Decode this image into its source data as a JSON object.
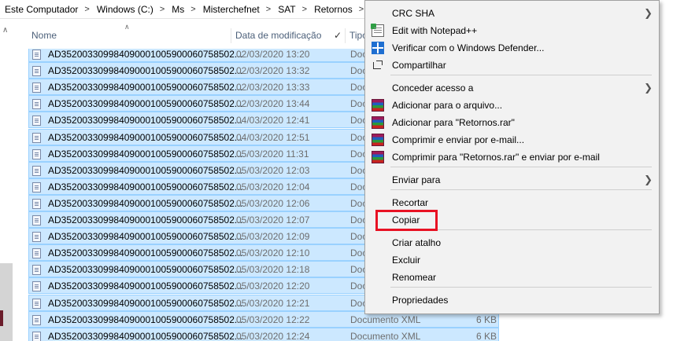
{
  "breadcrumb": [
    "Este Computador",
    "Windows (C:)",
    "Ms",
    "Misterchefnet",
    "SAT",
    "Retornos"
  ],
  "columns": {
    "name": "Nome",
    "date": "Data de modificação",
    "type": "Tipo"
  },
  "files": [
    {
      "name": "AD352003309984090001005900060758502...",
      "date": "02/03/2020 13:20",
      "type": "Doc",
      "size": "",
      "selected": true
    },
    {
      "name": "AD352003309984090001005900060758502...",
      "date": "02/03/2020 13:32",
      "type": "Doc",
      "size": "",
      "selected": true
    },
    {
      "name": "AD352003309984090001005900060758502...",
      "date": "02/03/2020 13:33",
      "type": "Doc",
      "size": "",
      "selected": true
    },
    {
      "name": "AD352003309984090001005900060758502...",
      "date": "02/03/2020 13:44",
      "type": "Doc",
      "size": "",
      "selected": true
    },
    {
      "name": "AD352003309984090001005900060758502...",
      "date": "04/03/2020 12:41",
      "type": "Doc",
      "size": "",
      "selected": true
    },
    {
      "name": "AD352003309984090001005900060758502...",
      "date": "04/03/2020 12:51",
      "type": "Doc",
      "size": "",
      "selected": true
    },
    {
      "name": "AD352003309984090001005900060758502...",
      "date": "05/03/2020 11:31",
      "type": "Doc",
      "size": "",
      "selected": true
    },
    {
      "name": "AD352003309984090001005900060758502...",
      "date": "05/03/2020 12:03",
      "type": "Doc",
      "size": "",
      "selected": true
    },
    {
      "name": "AD352003309984090001005900060758502...",
      "date": "05/03/2020 12:04",
      "type": "Doc",
      "size": "",
      "selected": true
    },
    {
      "name": "AD352003309984090001005900060758502...",
      "date": "05/03/2020 12:06",
      "type": "Doc",
      "size": "",
      "selected": true
    },
    {
      "name": "AD352003309984090001005900060758502...",
      "date": "05/03/2020 12:07",
      "type": "Doc",
      "size": "",
      "selected": true
    },
    {
      "name": "AD352003309984090001005900060758502...",
      "date": "05/03/2020 12:09",
      "type": "Doc",
      "size": "",
      "selected": true
    },
    {
      "name": "AD352003309984090001005900060758502...",
      "date": "05/03/2020 12:10",
      "type": "Doc",
      "size": "",
      "selected": true
    },
    {
      "name": "AD352003309984090001005900060758502...",
      "date": "05/03/2020 12:18",
      "type": "Doc",
      "size": "",
      "selected": true
    },
    {
      "name": "AD352003309984090001005900060758502...",
      "date": "05/03/2020 12:20",
      "type": "Doc",
      "size": "",
      "selected": true
    },
    {
      "name": "AD352003309984090001005900060758502...",
      "date": "05/03/2020 12:21",
      "type": "Doc",
      "size": "",
      "selected": true
    },
    {
      "name": "AD352003309984090001005900060758502...",
      "date": "05/03/2020 12:22",
      "type": "Documento XML",
      "size": "6 KB",
      "selected": true
    },
    {
      "name": "AD352003309984090001005900060758502...",
      "date": "05/03/2020 12:24",
      "type": "Documento XML",
      "size": "6 KB",
      "selected": true
    }
  ],
  "context_menu": {
    "items": [
      {
        "name": "crc-sha",
        "label": "CRC SHA",
        "icon": "",
        "submenu": true
      },
      {
        "name": "edit-notepad",
        "label": "Edit with Notepad++",
        "icon": "notepad-plus-plus-icon",
        "submenu": false
      },
      {
        "name": "defender",
        "label": "Verificar com o Windows Defender...",
        "icon": "windows-defender-icon",
        "submenu": false
      },
      {
        "name": "share",
        "label": "Compartilhar",
        "icon": "share-icon",
        "submenu": false
      },
      {
        "name": "grant-access",
        "label": "Conceder acesso a",
        "icon": "",
        "submenu": true
      },
      {
        "name": "add-archive",
        "label": "Adicionar para o arquivo...",
        "icon": "winrar-icon",
        "submenu": false
      },
      {
        "name": "add-rar",
        "label": "Adicionar para \"Retornos.rar\"",
        "icon": "winrar-icon",
        "submenu": false
      },
      {
        "name": "compress-email",
        "label": "Comprimir e enviar por e-mail...",
        "icon": "winrar-icon",
        "submenu": false
      },
      {
        "name": "compress-rar-email",
        "label": "Comprimir para \"Retornos.rar\" e enviar por e-mail",
        "icon": "winrar-icon",
        "submenu": false
      },
      {
        "name": "send-to",
        "label": "Enviar para",
        "icon": "",
        "submenu": true
      },
      {
        "name": "cut",
        "label": "Recortar",
        "icon": "",
        "submenu": false
      },
      {
        "name": "copy",
        "label": "Copiar",
        "icon": "",
        "submenu": false,
        "highlighted": true
      },
      {
        "name": "create-shortcut",
        "label": "Criar atalho",
        "icon": "",
        "submenu": false
      },
      {
        "name": "delete",
        "label": "Excluir",
        "icon": "",
        "submenu": false
      },
      {
        "name": "rename",
        "label": "Renomear",
        "icon": "",
        "submenu": false
      },
      {
        "name": "properties",
        "label": "Propriedades",
        "icon": "",
        "submenu": false
      }
    ]
  },
  "colors": {
    "selection_bg": "#cce8ff",
    "selection_border": "#99d1ff",
    "menu_bg": "#f2f2f2",
    "highlight_box": "#e81123"
  }
}
